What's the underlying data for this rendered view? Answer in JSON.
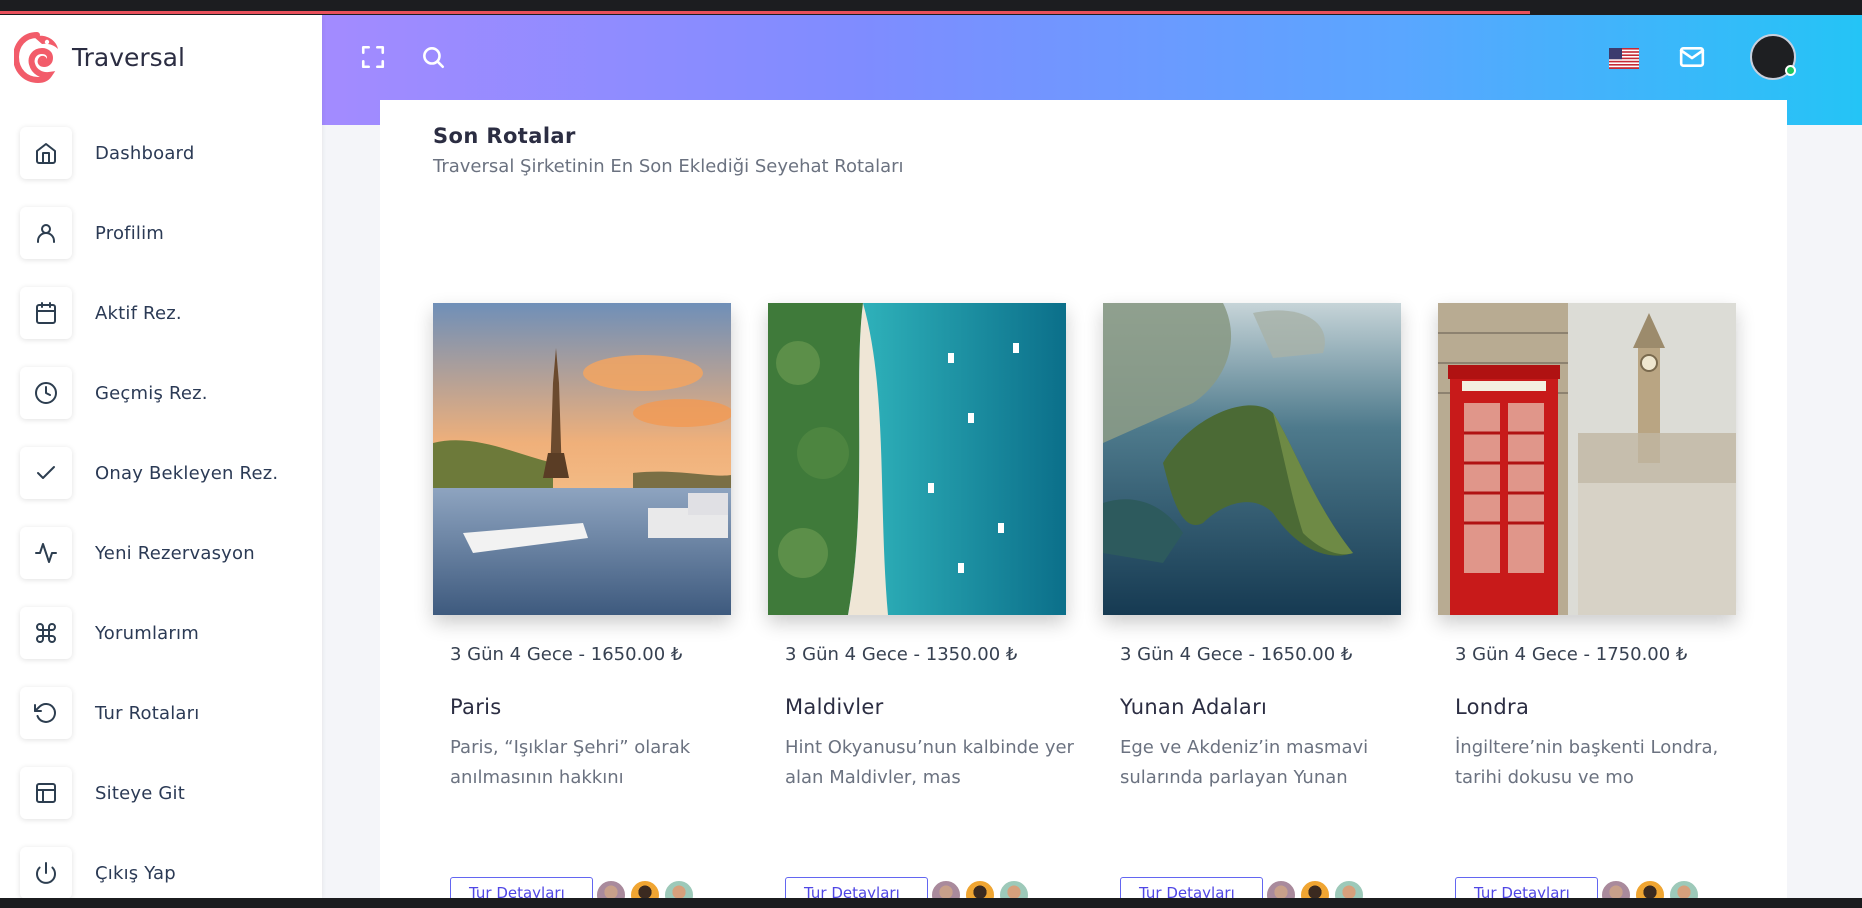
{
  "app": {
    "name": "Traversal"
  },
  "sidebar": {
    "items": [
      {
        "label": "Dashboard",
        "icon": "home-icon"
      },
      {
        "label": "Profilim",
        "icon": "user-icon"
      },
      {
        "label": "Aktif Rez.",
        "icon": "calendar-icon"
      },
      {
        "label": "Geçmiş Rez.",
        "icon": "clock-icon"
      },
      {
        "label": "Onay Bekleyen Rez.",
        "icon": "check-icon"
      },
      {
        "label": "Yeni Rezervasyon",
        "icon": "activity-icon"
      },
      {
        "label": "Yorumlarım",
        "icon": "command-icon"
      },
      {
        "label": "Tur Rotaları",
        "icon": "rotate-ccw-icon"
      },
      {
        "label": "Siteye Git",
        "icon": "layout-icon"
      },
      {
        "label": "Çıkış Yap",
        "icon": "power-icon"
      }
    ]
  },
  "header": {
    "icons": [
      "fullscreen-icon",
      "search-icon",
      "us-flag-icon",
      "mail-icon",
      "user-avatar"
    ]
  },
  "main": {
    "title": "Son Rotalar",
    "subtitle": "Traversal Şirketinin En Son Eklediği Seyehat Rotaları",
    "tours": [
      {
        "meta": "3 Gün 4 Gece - 1650.00 ₺",
        "name": "Paris",
        "description": "Paris, “Işıklar Şehri” olarak anılmasının hakkını",
        "button": "Tur Detayları"
      },
      {
        "meta": "3 Gün 4 Gece - 1350.00 ₺",
        "name": "Maldivler",
        "description": "Hint Okyanusu’nun kalbinde yer alan Maldivler, mas",
        "button": "Tur Detayları"
      },
      {
        "meta": "3 Gün 4 Gece - 1650.00 ₺",
        "name": "Yunan Adaları",
        "description": "Ege ve Akdeniz’in masmavi sularında parlayan Yunan",
        "button": "Tur Detayları"
      },
      {
        "meta": "3 Gün 4 Gece - 1750.00 ₺",
        "name": "Londra",
        "description": "İngiltere’nin başkenti Londra, tarihi dokusu ve mo",
        "button": "Tur Detayları"
      }
    ]
  },
  "colors": {
    "brand": "#f25c6a",
    "accent": "#6366f1",
    "online": "#22c55e"
  }
}
